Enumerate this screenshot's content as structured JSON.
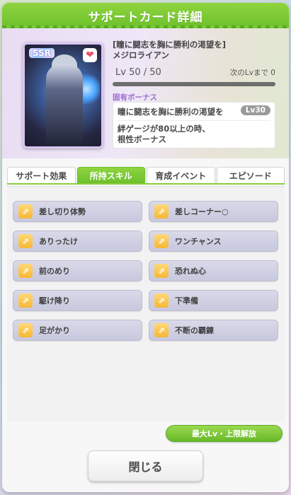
{
  "dialog": {
    "title": "サポートカード詳細"
  },
  "card": {
    "rarity": "SSR",
    "subtitle": "[瞳に闘志を胸に勝利の渇望を]",
    "name": "メジロライアン",
    "level": "Lv 50 / 50",
    "next_level": "次のLvまで 0",
    "favorite_icon": "heart-icon"
  },
  "unique_bonus": {
    "label": "固有ボーナス",
    "name": "瞳に闘志を胸に勝利の渇望を",
    "unlock_level": "Lv30",
    "description_line1": "絆ゲージが80以上の時、",
    "description_line2": "根性ボーナス"
  },
  "tabs": [
    {
      "label": "サポート効果",
      "active": false
    },
    {
      "label": "所持スキル",
      "active": true
    },
    {
      "label": "育成イベント",
      "active": false
    },
    {
      "label": "エピソード",
      "active": false
    }
  ],
  "skills": [
    {
      "name": "差し切り体勢",
      "icon": "skill-icon"
    },
    {
      "name": "差しコーナー○",
      "icon": "skill-icon"
    },
    {
      "name": "ありったけ",
      "icon": "skill-icon"
    },
    {
      "name": "ワンチャンス",
      "icon": "skill-icon"
    },
    {
      "name": "前のめり",
      "icon": "skill-icon"
    },
    {
      "name": "恐れぬ心",
      "icon": "skill-icon"
    },
    {
      "name": "駆け降り",
      "icon": "skill-icon"
    },
    {
      "name": "下準備",
      "icon": "skill-icon"
    },
    {
      "name": "足がかり",
      "icon": "skill-icon"
    },
    {
      "name": "不断の覇錬",
      "icon": "skill-icon"
    }
  ],
  "buttons": {
    "unlock_label": "最大Lv・上限解放",
    "close_label": "閉じる"
  },
  "colors": {
    "accent": "#6cc02c",
    "bonus_label": "#9c6bd1",
    "skill_bg": "#d3d3e6"
  }
}
